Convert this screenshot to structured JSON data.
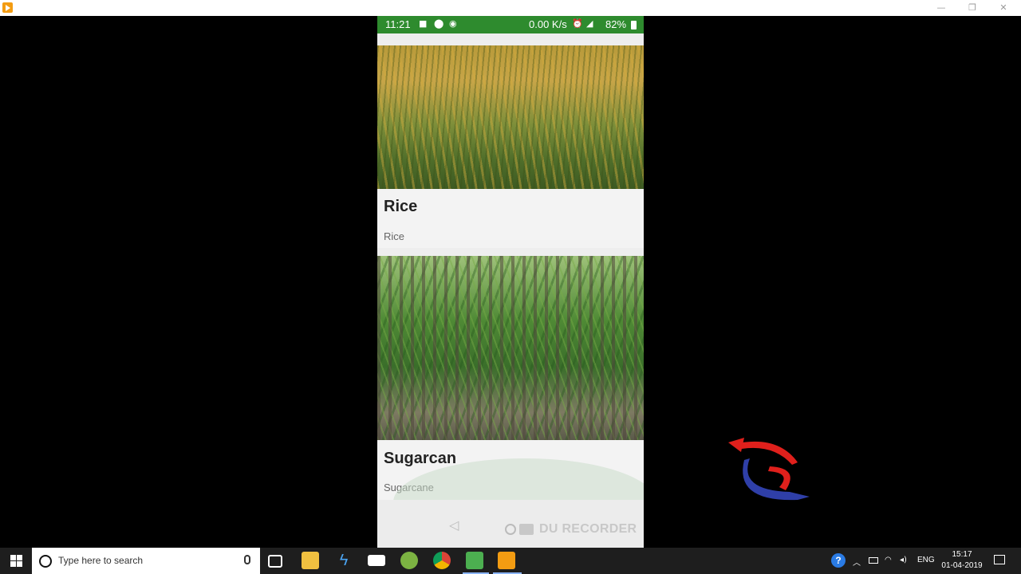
{
  "window": {
    "controls": [
      "—",
      "❐",
      "✕"
    ]
  },
  "status_bar": {
    "time": "11:21",
    "net_speed": "0.00 K/s",
    "battery": "82%",
    "icons": [
      "video-camera-icon",
      "location-pin-icon",
      "whatsapp-icon",
      "alarm-icon",
      "signal-icon",
      "battery-icon"
    ]
  },
  "crops": [
    {
      "title": "Rice",
      "subtitle": "Rice",
      "image": "rice-field-photo"
    },
    {
      "title": "Sugarcan",
      "subtitle": "Sugarcane",
      "image": "sugarcane-field-photo"
    }
  ],
  "nav_bar": {
    "back_glyph": "◁",
    "recorder_label": "DU RECORDER"
  },
  "taskbar": {
    "search_placeholder": "Type here to search",
    "apps": [
      "task-view-icon",
      "file-explorer-icon",
      "sublime-icon",
      "mail-icon",
      "android-studio-icon",
      "chrome-icon",
      "notepad-icon",
      "media-player-icon"
    ],
    "tray_lang": "ENG",
    "clock_time": "15:17",
    "clock_date": "01-04-2019"
  },
  "colors": {
    "status_bar": "#2e8b2e",
    "taskbar": "#1e1e1e",
    "card_bg": "#f3f3f3"
  }
}
